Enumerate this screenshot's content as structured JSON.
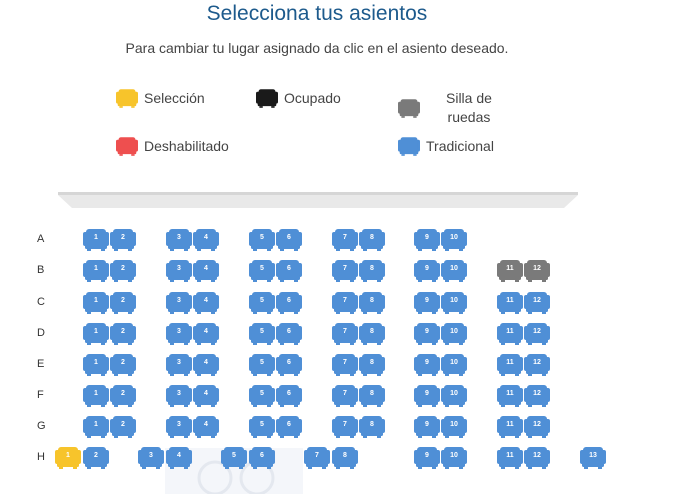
{
  "header": {
    "title": "Selecciona tus asientos",
    "subtitle": "Para cambiar tu lugar asignado da clic en el asiento deseado."
  },
  "legend": [
    {
      "key": "seleccion",
      "label": "Selección",
      "color": "#f7c42b",
      "icon": "seat-icon"
    },
    {
      "key": "ocupado",
      "label": "Ocupado",
      "color": "#1a1a1a",
      "icon": "seat-icon"
    },
    {
      "key": "silla",
      "label": "Silla de\nruedas",
      "color": "#7a7a7a",
      "icon": "seat-icon"
    },
    {
      "key": "deshabilitado",
      "label": "Deshabilitado",
      "color": "#ee4f4f",
      "icon": "seat-icon"
    },
    {
      "key": "tradicional",
      "label": "Tradicional",
      "color": "#4f8fd6",
      "icon": "seat-icon"
    }
  ],
  "statusColors": {
    "seleccion": "#f7c42b",
    "ocupado": "#1a1a1a",
    "silla": "#7a7a7a",
    "deshabilitado": "#ee4f4f",
    "tradicional": "#4f8fd6"
  },
  "rows": [
    {
      "label": "A",
      "seats": [
        {
          "n": "1",
          "s": "tradicional"
        },
        {
          "n": "2",
          "s": "tradicional"
        },
        {
          "n": "3",
          "s": "tradicional"
        },
        {
          "n": "4",
          "s": "tradicional"
        },
        {
          "n": "5",
          "s": "tradicional"
        },
        {
          "n": "6",
          "s": "tradicional"
        },
        {
          "n": "7",
          "s": "tradicional"
        },
        {
          "n": "8",
          "s": "tradicional"
        },
        {
          "n": "9",
          "s": "tradicional"
        },
        {
          "n": "10",
          "s": "tradicional"
        }
      ]
    },
    {
      "label": "B",
      "seats": [
        {
          "n": "1",
          "s": "tradicional"
        },
        {
          "n": "2",
          "s": "tradicional"
        },
        {
          "n": "3",
          "s": "tradicional"
        },
        {
          "n": "4",
          "s": "tradicional"
        },
        {
          "n": "5",
          "s": "tradicional"
        },
        {
          "n": "6",
          "s": "tradicional"
        },
        {
          "n": "7",
          "s": "tradicional"
        },
        {
          "n": "8",
          "s": "tradicional"
        },
        {
          "n": "9",
          "s": "tradicional"
        },
        {
          "n": "10",
          "s": "tradicional"
        },
        {
          "n": "11",
          "s": "silla"
        },
        {
          "n": "12",
          "s": "silla"
        }
      ]
    },
    {
      "label": "C",
      "seats": [
        {
          "n": "1",
          "s": "tradicional"
        },
        {
          "n": "2",
          "s": "tradicional"
        },
        {
          "n": "3",
          "s": "tradicional"
        },
        {
          "n": "4",
          "s": "tradicional"
        },
        {
          "n": "5",
          "s": "tradicional"
        },
        {
          "n": "6",
          "s": "tradicional"
        },
        {
          "n": "7",
          "s": "tradicional"
        },
        {
          "n": "8",
          "s": "tradicional"
        },
        {
          "n": "9",
          "s": "tradicional"
        },
        {
          "n": "10",
          "s": "tradicional"
        },
        {
          "n": "11",
          "s": "tradicional"
        },
        {
          "n": "12",
          "s": "tradicional"
        }
      ]
    },
    {
      "label": "D",
      "seats": [
        {
          "n": "1",
          "s": "tradicional"
        },
        {
          "n": "2",
          "s": "tradicional"
        },
        {
          "n": "3",
          "s": "tradicional"
        },
        {
          "n": "4",
          "s": "tradicional"
        },
        {
          "n": "5",
          "s": "tradicional"
        },
        {
          "n": "6",
          "s": "tradicional"
        },
        {
          "n": "7",
          "s": "tradicional"
        },
        {
          "n": "8",
          "s": "tradicional"
        },
        {
          "n": "9",
          "s": "tradicional"
        },
        {
          "n": "10",
          "s": "tradicional"
        },
        {
          "n": "11",
          "s": "tradicional"
        },
        {
          "n": "12",
          "s": "tradicional"
        }
      ]
    },
    {
      "label": "E",
      "seats": [
        {
          "n": "1",
          "s": "tradicional"
        },
        {
          "n": "2",
          "s": "tradicional"
        },
        {
          "n": "3",
          "s": "tradicional"
        },
        {
          "n": "4",
          "s": "tradicional"
        },
        {
          "n": "5",
          "s": "tradicional"
        },
        {
          "n": "6",
          "s": "tradicional"
        },
        {
          "n": "7",
          "s": "tradicional"
        },
        {
          "n": "8",
          "s": "tradicional"
        },
        {
          "n": "9",
          "s": "tradicional"
        },
        {
          "n": "10",
          "s": "tradicional"
        },
        {
          "n": "11",
          "s": "tradicional"
        },
        {
          "n": "12",
          "s": "tradicional"
        }
      ]
    },
    {
      "label": "F",
      "seats": [
        {
          "n": "1",
          "s": "tradicional"
        },
        {
          "n": "2",
          "s": "tradicional"
        },
        {
          "n": "3",
          "s": "tradicional"
        },
        {
          "n": "4",
          "s": "tradicional"
        },
        {
          "n": "5",
          "s": "tradicional"
        },
        {
          "n": "6",
          "s": "tradicional"
        },
        {
          "n": "7",
          "s": "tradicional"
        },
        {
          "n": "8",
          "s": "tradicional"
        },
        {
          "n": "9",
          "s": "tradicional"
        },
        {
          "n": "10",
          "s": "tradicional"
        },
        {
          "n": "11",
          "s": "tradicional"
        },
        {
          "n": "12",
          "s": "tradicional"
        }
      ]
    },
    {
      "label": "G",
      "seats": [
        {
          "n": "1",
          "s": "tradicional"
        },
        {
          "n": "2",
          "s": "tradicional"
        },
        {
          "n": "3",
          "s": "tradicional"
        },
        {
          "n": "4",
          "s": "tradicional"
        },
        {
          "n": "5",
          "s": "tradicional"
        },
        {
          "n": "6",
          "s": "tradicional"
        },
        {
          "n": "7",
          "s": "tradicional"
        },
        {
          "n": "8",
          "s": "tradicional"
        },
        {
          "n": "9",
          "s": "tradicional"
        },
        {
          "n": "10",
          "s": "tradicional"
        },
        {
          "n": "11",
          "s": "tradicional"
        },
        {
          "n": "12",
          "s": "tradicional"
        }
      ]
    },
    {
      "label": "H",
      "seats": [
        {
          "n": "1",
          "s": "seleccion"
        },
        {
          "n": "2",
          "s": "tradicional"
        },
        {
          "n": "3",
          "s": "tradicional"
        },
        {
          "n": "4",
          "s": "tradicional"
        },
        {
          "n": "5",
          "s": "tradicional"
        },
        {
          "n": "6",
          "s": "tradicional"
        },
        {
          "n": "7",
          "s": "tradicional"
        },
        {
          "n": "8",
          "s": "tradicional"
        },
        {
          "n": "9",
          "s": "tradicional"
        },
        {
          "n": "10",
          "s": "tradicional"
        },
        {
          "n": "11",
          "s": "tradicional"
        },
        {
          "n": "12",
          "s": "tradicional"
        },
        {
          "n": "13",
          "s": "tradicional"
        }
      ]
    }
  ]
}
